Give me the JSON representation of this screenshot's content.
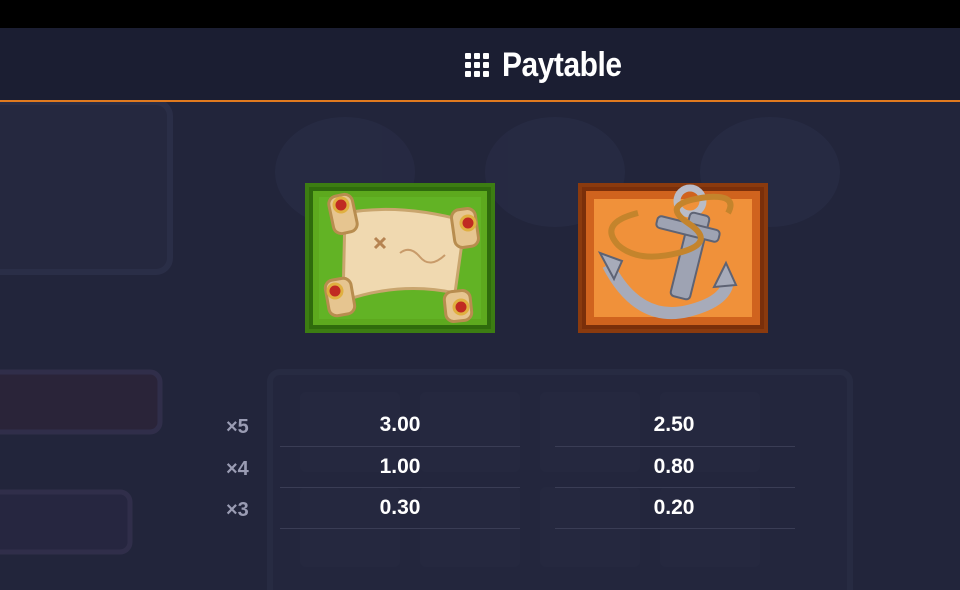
{
  "header": {
    "title": "Paytable",
    "icon": "grid-dots-icon",
    "accent_color": "#e07a1f"
  },
  "symbols": [
    {
      "name": "scroll-map",
      "icon": "scroll-symbol-icon"
    },
    {
      "name": "anchor",
      "icon": "anchor-symbol-icon"
    }
  ],
  "paytable": [
    {
      "multiplier": "×5",
      "values": [
        "3.00",
        "2.50"
      ]
    },
    {
      "multiplier": "×4",
      "values": [
        "1.00",
        "0.80"
      ]
    },
    {
      "multiplier": "×3",
      "values": [
        "0.30",
        "0.20"
      ]
    }
  ]
}
